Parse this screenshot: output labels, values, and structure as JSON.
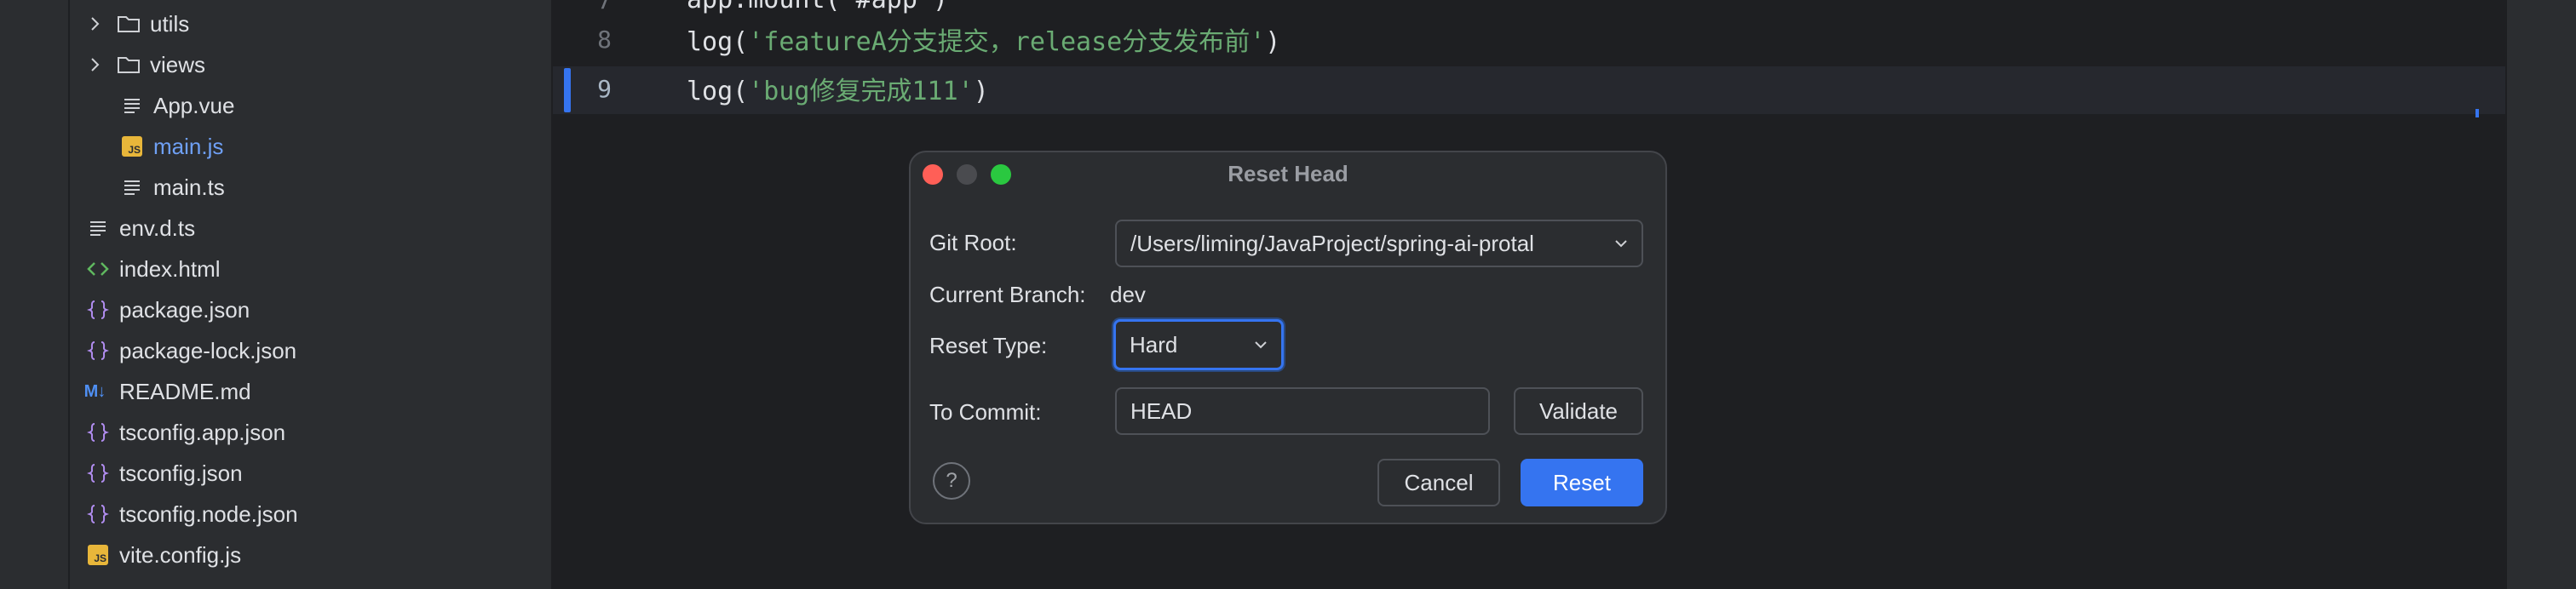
{
  "project_tree": {
    "items": [
      {
        "kind": "folder",
        "label": "utils",
        "expandable": true
      },
      {
        "kind": "folder",
        "label": "views",
        "expandable": true
      },
      {
        "kind": "file",
        "icon": "text-file-icon",
        "label": "App.vue"
      },
      {
        "kind": "file",
        "icon": "js-file-icon",
        "label": "main.js",
        "active": true
      },
      {
        "kind": "file",
        "icon": "text-file-icon",
        "label": "main.ts"
      },
      {
        "kind": "file",
        "icon": "text-file-icon",
        "label": "env.d.ts"
      },
      {
        "kind": "file",
        "icon": "html-file-icon",
        "label": "index.html"
      },
      {
        "kind": "file",
        "icon": "json-file-icon",
        "label": "package.json"
      },
      {
        "kind": "file",
        "icon": "json-file-icon",
        "label": "package-lock.json"
      },
      {
        "kind": "file",
        "icon": "markdown-file-icon",
        "label": "README.md"
      },
      {
        "kind": "file",
        "icon": "json-file-icon",
        "label": "tsconfig.app.json"
      },
      {
        "kind": "file",
        "icon": "json-file-icon",
        "label": "tsconfig.json"
      },
      {
        "kind": "file",
        "icon": "json-file-icon",
        "label": "tsconfig.node.json"
      },
      {
        "kind": "file",
        "icon": "js-file-icon",
        "label": "vite.config.js"
      }
    ]
  },
  "editor": {
    "lines": [
      {
        "number": "8",
        "fn": "log(",
        "str": "'featureA分支提交，release分支发布前'",
        "close": ")"
      },
      {
        "number": "9",
        "fn": "log(",
        "str": "'bug修复完成111'",
        "close": ")",
        "current": true
      }
    ]
  },
  "dialog": {
    "title": "Reset Head",
    "git_root_label": "Git Root:",
    "git_root_value": "/Users/liming/JavaProject/spring-ai-protal",
    "current_branch_label": "Current Branch:",
    "current_branch_value": "dev",
    "reset_type_label": "Reset Type:",
    "reset_type_value": "Hard",
    "to_commit_label": "To Commit:",
    "to_commit_value": "HEAD",
    "validate_label": "Validate",
    "cancel_label": "Cancel",
    "reset_label": "Reset",
    "help_glyph": "?"
  },
  "colors": {
    "accent": "#3574f0",
    "string": "#6aab73",
    "active_file": "#6fa0f5",
    "close_dot": "#ff5f57"
  }
}
